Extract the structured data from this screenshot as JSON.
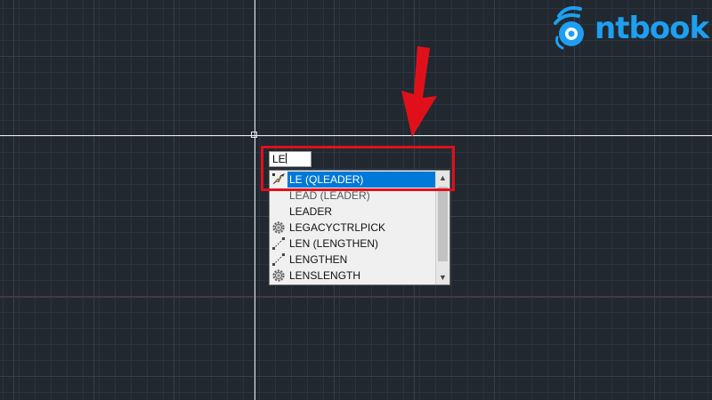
{
  "command_line": {
    "typed_value": "LE"
  },
  "autocomplete": {
    "items": [
      {
        "label": "LE (QLEADER)",
        "icon": "leader-arrow-icon",
        "selected": true
      },
      {
        "label": "LEAD (LEADER)",
        "icon": "",
        "selected": false
      },
      {
        "label": "LEADER",
        "icon": "",
        "selected": false
      },
      {
        "label": "LEGACYCTRLPICK",
        "icon": "gear-icon",
        "selected": false
      },
      {
        "label": "LEN (LENGTHEN)",
        "icon": "lengthen-line-icon",
        "selected": false
      },
      {
        "label": "LENGTHEN",
        "icon": "lengthen-line-icon",
        "selected": false
      },
      {
        "label": "LENSLENGTH",
        "icon": "gear-icon",
        "selected": false
      }
    ]
  },
  "watermark": {
    "text": "ntbook"
  },
  "colors": {
    "background": "#212830",
    "selection": "#0078d7",
    "annotation_red": "#e0101a",
    "logo_blue": "#1e9ff0"
  }
}
